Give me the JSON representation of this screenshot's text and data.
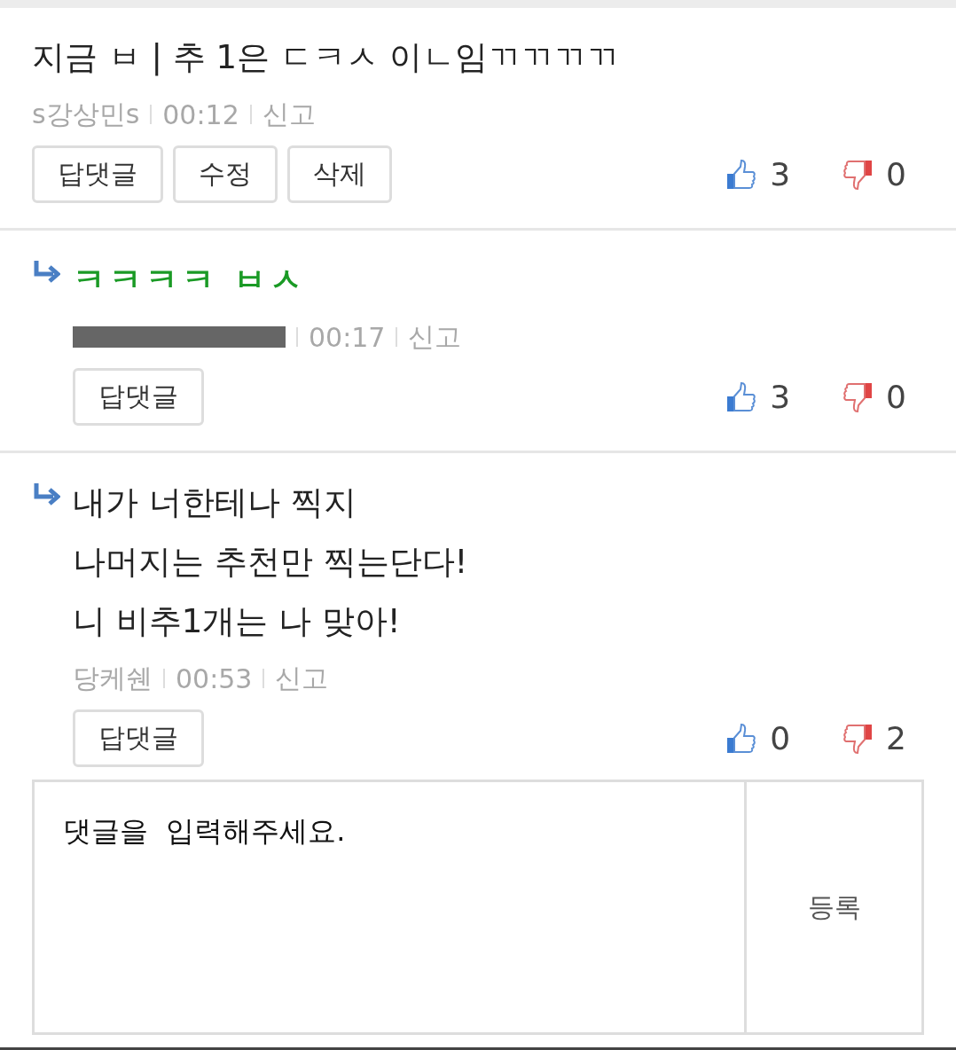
{
  "comments": [
    {
      "kind": "comment",
      "lines": [
        "지금 ㅂ | 추 1은 ㄷㅋㅅ 이ㄴ임ㄲㄲㄲㄲ"
      ],
      "highlight": false,
      "author": "s강상민s",
      "author_redacted": false,
      "time": "00:12",
      "report": "신고",
      "buttons": [
        "답댓글",
        "수정",
        "삭제"
      ],
      "likes": "3",
      "dislikes": "0"
    },
    {
      "kind": "reply",
      "lines": [
        "ㅋㅋㅋㅋ ㅂㅅ"
      ],
      "highlight": true,
      "author_redacted": true,
      "time": "00:17",
      "report": "신고",
      "buttons": [
        "답댓글"
      ],
      "likes": "3",
      "dislikes": "0"
    },
    {
      "kind": "reply",
      "lines": [
        "내가 너한테나 찍지",
        "나머지는 추천만 찍는단다!",
        "니 비추1개는 나 맞아!"
      ],
      "highlight": false,
      "author": "당케쉔",
      "author_redacted": false,
      "time": "00:53",
      "report": "신고",
      "buttons": [
        "답댓글"
      ],
      "likes": "0",
      "dislikes": "2"
    }
  ],
  "composer": {
    "placeholder": "댓글을  입력해주세요.",
    "submit": "등록"
  }
}
